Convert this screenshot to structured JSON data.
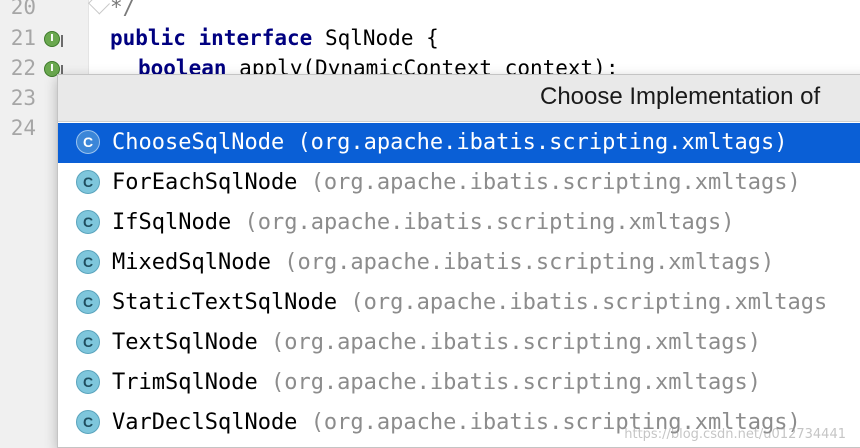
{
  "editor": {
    "line_numbers": [
      "20",
      "21",
      "22",
      "23",
      "24"
    ],
    "code": {
      "line20": "*/",
      "line21_kw1": "public",
      "line21_kw2": "interface",
      "line21_rest": "SqlNode {",
      "line22_kw": "boolean",
      "line22_rest": "apply(DynamicContext context);"
    },
    "impl_badge": "I"
  },
  "popup": {
    "title": "Choose Implementation of",
    "class_icon_letter": "C",
    "items": [
      {
        "name": "ChooseSqlNode",
        "package": "(org.apache.ibatis.scripting.xmltags)",
        "selected": true
      },
      {
        "name": "ForEachSqlNode",
        "package": "(org.apache.ibatis.scripting.xmltags)",
        "selected": false
      },
      {
        "name": "IfSqlNode",
        "package": "(org.apache.ibatis.scripting.xmltags)",
        "selected": false
      },
      {
        "name": "MixedSqlNode",
        "package": "(org.apache.ibatis.scripting.xmltags)",
        "selected": false
      },
      {
        "name": "StaticTextSqlNode",
        "package": "(org.apache.ibatis.scripting.xmltags",
        "selected": false
      },
      {
        "name": "TextSqlNode",
        "package": "(org.apache.ibatis.scripting.xmltags)",
        "selected": false
      },
      {
        "name": "TrimSqlNode",
        "package": "(org.apache.ibatis.scripting.xmltags)",
        "selected": false
      },
      {
        "name": "VarDeclSqlNode",
        "package": "(org.apache.ibatis.scripting.xmltags)",
        "selected": false
      }
    ]
  },
  "watermark": "https://blog.csdn.net/u012734441",
  "colors": {
    "selection": "#0a5fd6",
    "keyword": "#000080",
    "package_text": "#8c8c8c",
    "class_icon": "#7ec6dc"
  }
}
